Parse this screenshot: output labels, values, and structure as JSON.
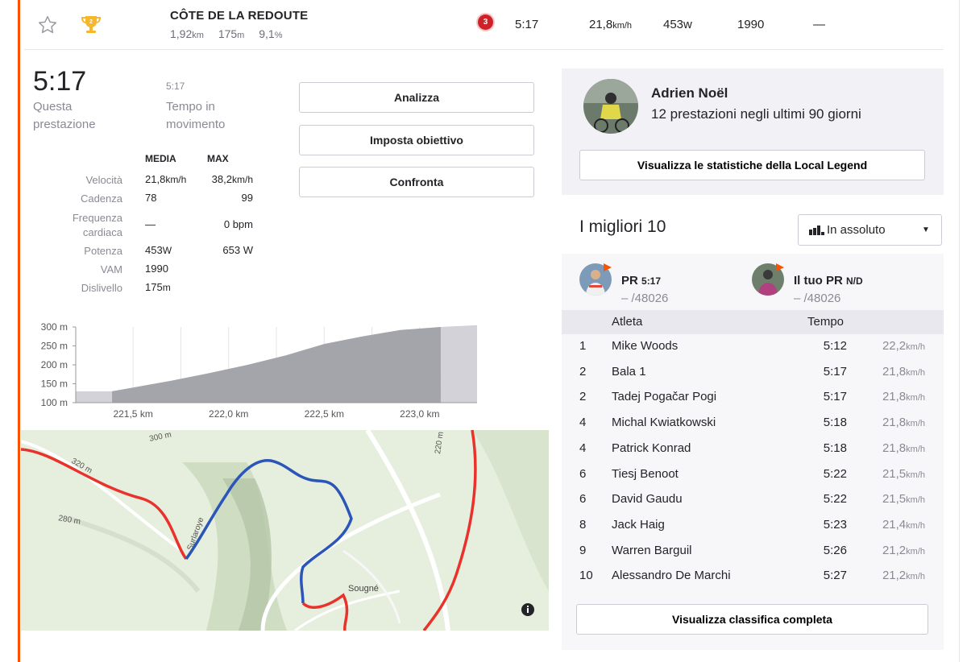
{
  "segment": {
    "name": "CÔTE DE LA REDOUTE",
    "distance": "1,92",
    "distance_unit": "km",
    "elevation": "175",
    "elevation_unit": "m",
    "grade": "9,1",
    "grade_unit": "%",
    "rank_badge": "3",
    "time": "5:17",
    "speed": "21,8",
    "speed_unit": "km/h",
    "power": "453",
    "power_unit": "w",
    "vam": "1990",
    "hr": "—"
  },
  "effort": {
    "elapsed_time": "5:17",
    "elapsed_label": "Questa prestazione",
    "moving_time": "5:17",
    "moving_label": "Tempo in movimento"
  },
  "actions": {
    "analyze": "Analizza",
    "set_goal": "Imposta obiettivo",
    "compare": "Confronta"
  },
  "stats": {
    "head_avg": "MEDIA",
    "head_max": "MAX",
    "rows": [
      {
        "label": "Velocità",
        "avg": "21,8",
        "avg_unit": "km/h",
        "max": "38,2",
        "max_unit": "km/h"
      },
      {
        "label": "Cadenza",
        "avg": "78",
        "avg_unit": "",
        "max": "99",
        "max_unit": ""
      },
      {
        "label": "Frequenza cardiaca",
        "avg": "—",
        "avg_unit": "",
        "max": "0 bpm",
        "max_unit": ""
      },
      {
        "label": "Potenza",
        "avg": "453",
        "avg_unit": "W",
        "max": "653 W",
        "max_unit": ""
      },
      {
        "label": "VAM",
        "avg": "1990",
        "avg_unit": "",
        "max": "",
        "max_unit": ""
      },
      {
        "label": "Dislivello",
        "avg": "175",
        "avg_unit": "m",
        "max": "",
        "max_unit": ""
      }
    ]
  },
  "chart_data": {
    "type": "area",
    "y_ticks": [
      "300 m",
      "250 m",
      "200 m",
      "150 m",
      "100 m"
    ],
    "x_ticks": [
      "221,5 km",
      "222,0 km",
      "222,5 km",
      "223,0 km"
    ],
    "ylim": [
      100,
      300
    ],
    "xlim": [
      221.2,
      223.3
    ],
    "segment_range": [
      221.39,
      223.11
    ],
    "x": [
      221.2,
      221.39,
      221.5,
      221.7,
      221.9,
      222.1,
      222.3,
      222.5,
      222.7,
      222.9,
      223.11,
      223.3
    ],
    "y": [
      130,
      130,
      140,
      158,
      178,
      200,
      225,
      255,
      275,
      292,
      300,
      305
    ]
  },
  "map": {
    "labels": [
      "300 m",
      "320 m",
      "280 m",
      "220 m",
      "Sougné",
      "Surlaroye"
    ],
    "info_icon": "info-icon"
  },
  "local_legend": {
    "name": "Adrien Noël",
    "subtitle": "12 prestazioni negli ultimi 90 giorni",
    "button": "Visualizza le statistiche della Local Legend"
  },
  "leaderboard": {
    "title": "I migliori 10",
    "filter_label": "In assoluto",
    "pr": {
      "label": "PR",
      "time": "5:17",
      "rank": "– /48026"
    },
    "your_pr": {
      "label": "Il tuo PR",
      "time": "N/D",
      "rank": "– /48026"
    },
    "col_athlete": "Atleta",
    "col_time": "Tempo",
    "rows": [
      {
        "rank": "1",
        "name": "Mike Woods",
        "time": "5:12",
        "speed": "22,2"
      },
      {
        "rank": "2",
        "name": "Bala 1",
        "time": "5:17",
        "speed": "21,8"
      },
      {
        "rank": "2",
        "name": "Tadej Pogačar Pogi",
        "time": "5:17",
        "speed": "21,8"
      },
      {
        "rank": "4",
        "name": "Michal Kwiatkowski",
        "time": "5:18",
        "speed": "21,8"
      },
      {
        "rank": "4",
        "name": "Patrick Konrad",
        "time": "5:18",
        "speed": "21,8"
      },
      {
        "rank": "6",
        "name": "Tiesj Benoot",
        "time": "5:22",
        "speed": "21,5"
      },
      {
        "rank": "6",
        "name": "David Gaudu",
        "time": "5:22",
        "speed": "21,5"
      },
      {
        "rank": "8",
        "name": "Jack Haig",
        "time": "5:23",
        "speed": "21,4"
      },
      {
        "rank": "9",
        "name": "Warren Barguil",
        "time": "5:26",
        "speed": "21,2"
      },
      {
        "rank": "10",
        "name": "Alessandro De Marchi",
        "time": "5:27",
        "speed": "21,2"
      }
    ],
    "speed_unit": "km/h",
    "full_button": "Visualizza classifica completa"
  },
  "colors": {
    "accent": "#fc5200",
    "route_red": "#e8322b",
    "route_blue": "#2b55b8",
    "badge_red": "#cf2127",
    "trophy_gold": "#f5b72c"
  }
}
